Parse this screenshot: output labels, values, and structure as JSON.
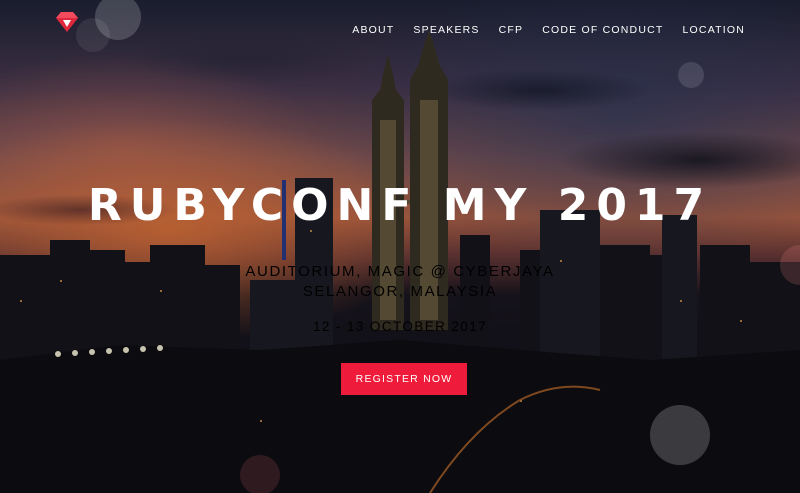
{
  "nav": {
    "logo_icon": "ruby-gem-icon",
    "brand_color": "#e0283c",
    "items": [
      {
        "label": "ABOUT"
      },
      {
        "label": "SPEAKERS"
      },
      {
        "label": "CFP"
      },
      {
        "label": "CODE OF CONDUCT"
      },
      {
        "label": "LOCATION"
      }
    ]
  },
  "hero": {
    "title": "RUBYCONF MY 2017",
    "venue_line1": "AUDITORIUM, MAGIC @ CYBERJAYA",
    "venue_line2": "SELANGOR, MALAYSIA",
    "dates": "12 - 13 OCTOBER 2017",
    "cta_label": "REGISTER NOW",
    "cta_color": "#ee1c3a"
  }
}
